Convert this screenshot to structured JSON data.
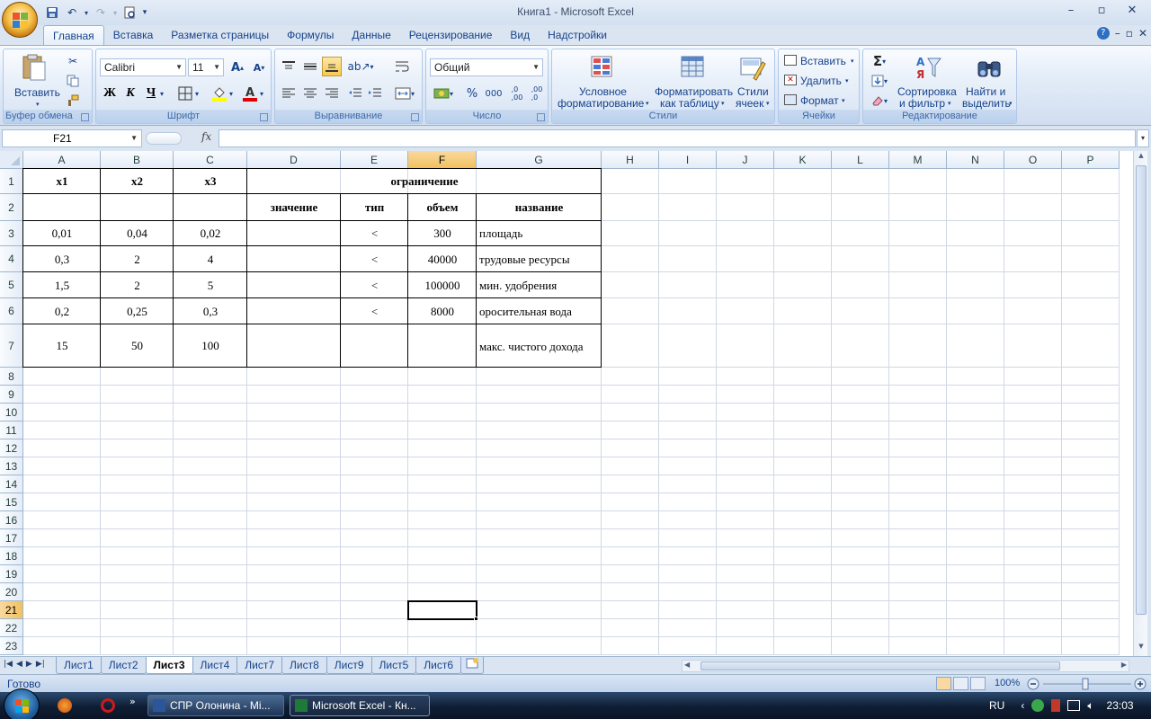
{
  "window": {
    "title": "Книга1 - Microsoft Excel"
  },
  "ribbon": {
    "tabs": [
      "Главная",
      "Вставка",
      "Разметка страницы",
      "Формулы",
      "Данные",
      "Рецензирование",
      "Вид",
      "Надстройки"
    ],
    "active_tab": "Главная",
    "clipboard": {
      "paste_label": "Вставить",
      "group_label": "Буфер обмена"
    },
    "font": {
      "name": "Calibri",
      "size": "11",
      "bold": "Ж",
      "italic": "К",
      "underline": "Ч",
      "group_label": "Шрифт"
    },
    "alignment": {
      "group_label": "Выравнивание"
    },
    "number": {
      "format": "Общий",
      "group_label": "Число"
    },
    "styles": {
      "conditional_line1": "Условное",
      "conditional_line2": "форматирование",
      "as_table_line1": "Форматировать",
      "as_table_line2": "как таблицу",
      "cell_styles_line1": "Стили",
      "cell_styles_line2": "ячеек",
      "group_label": "Стили"
    },
    "cells": {
      "insert": "Вставить",
      "delete": "Удалить",
      "format": "Формат",
      "group_label": "Ячейки"
    },
    "editing": {
      "sort_line1": "Сортировка",
      "sort_line2": "и фильтр",
      "find_line1": "Найти и",
      "find_line2": "выделить",
      "group_label": "Редактирование"
    }
  },
  "formula_bar": {
    "name_box": "F21",
    "fx": "fx",
    "formula": ""
  },
  "grid": {
    "columns": [
      "A",
      "B",
      "C",
      "D",
      "E",
      "F",
      "G",
      "H",
      "I",
      "J",
      "K",
      "L",
      "M",
      "N",
      "O",
      "P"
    ],
    "rows": [
      "1",
      "2",
      "3",
      "4",
      "5",
      "6",
      "7",
      "8",
      "9",
      "10",
      "11",
      "12",
      "13",
      "14",
      "15",
      "16",
      "17",
      "18",
      "19",
      "20",
      "21",
      "22",
      "23"
    ],
    "selected_cell": "F21",
    "cells": {
      "A1": "x1",
      "B1": "x2",
      "C1": "x3",
      "D1": "ограничение",
      "D2": "значение",
      "E2": "тип",
      "F2": "объем",
      "G2": "название",
      "A3": "0,01",
      "B3": "0,04",
      "C3": "0,02",
      "E3": "<",
      "F3": "300",
      "G3": "площадь",
      "A4": "0,3",
      "B4": "2",
      "C4": "4",
      "E4": "<",
      "F4": "40000",
      "G4": "трудовые ресурсы",
      "A5": "1,5",
      "B5": "2",
      "C5": "5",
      "E5": "<",
      "F5": "100000",
      "G5": "мин. удобрения",
      "A6": "0,2",
      "B6": "0,25",
      "C6": "0,3",
      "E6": "<",
      "F6": "8000",
      "G6": "оросительная вода",
      "A7": "15",
      "B7": "50",
      "C7": "100",
      "G7": "макс. чистого дохода"
    }
  },
  "sheets": {
    "tabs": [
      "Лист1",
      "Лист2",
      "Лист3",
      "Лист4",
      "Лист7",
      "Лист8",
      "Лист9",
      "Лист5",
      "Лист6"
    ],
    "active": "Лист3"
  },
  "status": {
    "text": "Готово",
    "zoom": "100%"
  },
  "taskbar": {
    "apps": [
      "СПР Олонина - Mi...",
      "Microsoft Excel - Кн..."
    ],
    "lang": "RU",
    "clock": "23:03"
  }
}
